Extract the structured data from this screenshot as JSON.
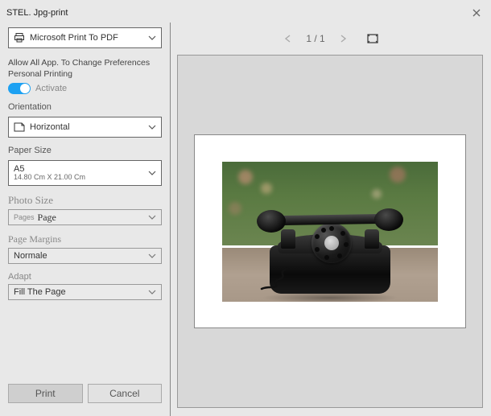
{
  "title": "STEL. Jpg-print",
  "printer": {
    "selected": "Microsoft Print To PDF"
  },
  "preferences": {
    "line1": "Allow All App. To Change Preferences",
    "line2": "Personal Printing",
    "activate_label": "Activate",
    "active": true
  },
  "orientation": {
    "label": "Orientation",
    "value": "Horizontal"
  },
  "paper_size": {
    "label": "Paper Size",
    "value": "A5",
    "dims": "14.80 Cm X 21.00 Cm"
  },
  "photo_size": {
    "label": "Photo Size",
    "prefix": "Pages",
    "value": "Page"
  },
  "margins": {
    "label": "Page Margins",
    "value": "Normale"
  },
  "adapt": {
    "label": "Adapt",
    "value": "Fill The Page"
  },
  "buttons": {
    "print": "Print",
    "cancel": "Cancel"
  },
  "pager": {
    "current": 1,
    "total": 1,
    "text": "1 / 1"
  }
}
